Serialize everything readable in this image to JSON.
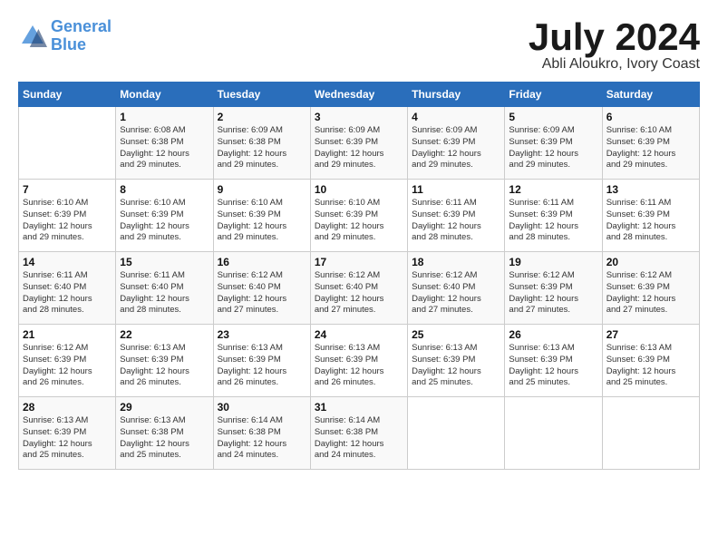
{
  "header": {
    "logo_line1": "General",
    "logo_line2": "Blue",
    "month_year": "July 2024",
    "location": "Abli Aloukro, Ivory Coast"
  },
  "days_of_week": [
    "Sunday",
    "Monday",
    "Tuesday",
    "Wednesday",
    "Thursday",
    "Friday",
    "Saturday"
  ],
  "weeks": [
    [
      {
        "day": "",
        "info": ""
      },
      {
        "day": "1",
        "info": "Sunrise: 6:08 AM\nSunset: 6:38 PM\nDaylight: 12 hours\nand 29 minutes."
      },
      {
        "day": "2",
        "info": "Sunrise: 6:09 AM\nSunset: 6:38 PM\nDaylight: 12 hours\nand 29 minutes."
      },
      {
        "day": "3",
        "info": "Sunrise: 6:09 AM\nSunset: 6:39 PM\nDaylight: 12 hours\nand 29 minutes."
      },
      {
        "day": "4",
        "info": "Sunrise: 6:09 AM\nSunset: 6:39 PM\nDaylight: 12 hours\nand 29 minutes."
      },
      {
        "day": "5",
        "info": "Sunrise: 6:09 AM\nSunset: 6:39 PM\nDaylight: 12 hours\nand 29 minutes."
      },
      {
        "day": "6",
        "info": "Sunrise: 6:10 AM\nSunset: 6:39 PM\nDaylight: 12 hours\nand 29 minutes."
      }
    ],
    [
      {
        "day": "7",
        "info": "Sunrise: 6:10 AM\nSunset: 6:39 PM\nDaylight: 12 hours\nand 29 minutes."
      },
      {
        "day": "8",
        "info": "Sunrise: 6:10 AM\nSunset: 6:39 PM\nDaylight: 12 hours\nand 29 minutes."
      },
      {
        "day": "9",
        "info": "Sunrise: 6:10 AM\nSunset: 6:39 PM\nDaylight: 12 hours\nand 29 minutes."
      },
      {
        "day": "10",
        "info": "Sunrise: 6:10 AM\nSunset: 6:39 PM\nDaylight: 12 hours\nand 29 minutes."
      },
      {
        "day": "11",
        "info": "Sunrise: 6:11 AM\nSunset: 6:39 PM\nDaylight: 12 hours\nand 28 minutes."
      },
      {
        "day": "12",
        "info": "Sunrise: 6:11 AM\nSunset: 6:39 PM\nDaylight: 12 hours\nand 28 minutes."
      },
      {
        "day": "13",
        "info": "Sunrise: 6:11 AM\nSunset: 6:39 PM\nDaylight: 12 hours\nand 28 minutes."
      }
    ],
    [
      {
        "day": "14",
        "info": "Sunrise: 6:11 AM\nSunset: 6:40 PM\nDaylight: 12 hours\nand 28 minutes."
      },
      {
        "day": "15",
        "info": "Sunrise: 6:11 AM\nSunset: 6:40 PM\nDaylight: 12 hours\nand 28 minutes."
      },
      {
        "day": "16",
        "info": "Sunrise: 6:12 AM\nSunset: 6:40 PM\nDaylight: 12 hours\nand 27 minutes."
      },
      {
        "day": "17",
        "info": "Sunrise: 6:12 AM\nSunset: 6:40 PM\nDaylight: 12 hours\nand 27 minutes."
      },
      {
        "day": "18",
        "info": "Sunrise: 6:12 AM\nSunset: 6:40 PM\nDaylight: 12 hours\nand 27 minutes."
      },
      {
        "day": "19",
        "info": "Sunrise: 6:12 AM\nSunset: 6:39 PM\nDaylight: 12 hours\nand 27 minutes."
      },
      {
        "day": "20",
        "info": "Sunrise: 6:12 AM\nSunset: 6:39 PM\nDaylight: 12 hours\nand 27 minutes."
      }
    ],
    [
      {
        "day": "21",
        "info": "Sunrise: 6:12 AM\nSunset: 6:39 PM\nDaylight: 12 hours\nand 26 minutes."
      },
      {
        "day": "22",
        "info": "Sunrise: 6:13 AM\nSunset: 6:39 PM\nDaylight: 12 hours\nand 26 minutes."
      },
      {
        "day": "23",
        "info": "Sunrise: 6:13 AM\nSunset: 6:39 PM\nDaylight: 12 hours\nand 26 minutes."
      },
      {
        "day": "24",
        "info": "Sunrise: 6:13 AM\nSunset: 6:39 PM\nDaylight: 12 hours\nand 26 minutes."
      },
      {
        "day": "25",
        "info": "Sunrise: 6:13 AM\nSunset: 6:39 PM\nDaylight: 12 hours\nand 25 minutes."
      },
      {
        "day": "26",
        "info": "Sunrise: 6:13 AM\nSunset: 6:39 PM\nDaylight: 12 hours\nand 25 minutes."
      },
      {
        "day": "27",
        "info": "Sunrise: 6:13 AM\nSunset: 6:39 PM\nDaylight: 12 hours\nand 25 minutes."
      }
    ],
    [
      {
        "day": "28",
        "info": "Sunrise: 6:13 AM\nSunset: 6:39 PM\nDaylight: 12 hours\nand 25 minutes."
      },
      {
        "day": "29",
        "info": "Sunrise: 6:13 AM\nSunset: 6:38 PM\nDaylight: 12 hours\nand 25 minutes."
      },
      {
        "day": "30",
        "info": "Sunrise: 6:14 AM\nSunset: 6:38 PM\nDaylight: 12 hours\nand 24 minutes."
      },
      {
        "day": "31",
        "info": "Sunrise: 6:14 AM\nSunset: 6:38 PM\nDaylight: 12 hours\nand 24 minutes."
      },
      {
        "day": "",
        "info": ""
      },
      {
        "day": "",
        "info": ""
      },
      {
        "day": "",
        "info": ""
      }
    ]
  ]
}
